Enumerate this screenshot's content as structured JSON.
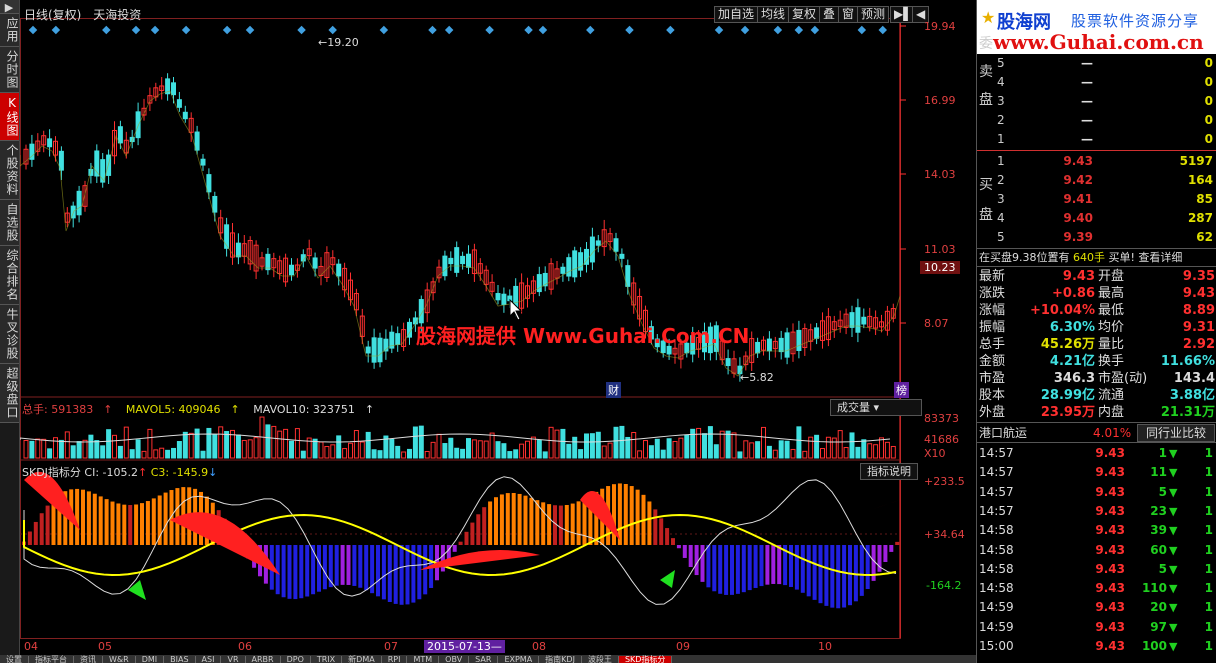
{
  "left_tabs": [
    "应用",
    "分时图",
    "K线图",
    "个股资料",
    "自选股",
    "综合排名",
    "牛叉诊股",
    "超级盘口"
  ],
  "chart_header": {
    "period": "日线(复权)",
    "stock": "天海投资"
  },
  "toolbar": [
    "加自选",
    "均线",
    "复权",
    "叠",
    "窗",
    "预测"
  ],
  "price_axis": [
    "19.94",
    "16.99",
    "14.03",
    "11.03",
    "10.23",
    "8.07"
  ],
  "peak_label": "19.20",
  "low_label": "5.82",
  "watermark": "股海网提供 Www.Guhai.Com.CN",
  "event_labels": {
    "fin": "财",
    "rank": "榜"
  },
  "volume": {
    "label": "总手: 591383",
    "mavol5": "MAVOL5: 409046",
    "mavol10": "MAVOL10: 323751",
    "axis": [
      "83373",
      "41686",
      "X10"
    ],
    "dropdown": "成交量"
  },
  "skdj": {
    "label": "SKDJ指标分",
    "c1": "CI: -105.2",
    "c3": "C3: -145.9",
    "button": "指标说明",
    "axis": [
      "+233.5",
      "+34.64",
      "-164.2"
    ]
  },
  "x_labels": [
    "04",
    "05",
    "06",
    "07",
    "08",
    "09",
    "10"
  ],
  "x_cursor_label": "2015-07-13—",
  "bottom_tabs": [
    "设置",
    "指标平台",
    "资讯",
    "W&R",
    "DMI",
    "BIAS",
    "ASI",
    "VR",
    "ARBR",
    "DPO",
    "TRIX",
    "新DMA",
    "RPI",
    "MTM",
    "OBV",
    "SAR",
    "EXPMA",
    "指南KDJ",
    "波段王",
    "SKD指标分"
  ],
  "banner": {
    "brand": "股海网",
    "slogan": "股票软件资源分享",
    "url": "www.Guhai.com.cn"
  },
  "side_labels": {
    "sell": "委卖盘",
    "buy": "买盘"
  },
  "sell_levels": [
    {
      "lv": "5",
      "price": "—",
      "vol": "0"
    },
    {
      "lv": "4",
      "price": "—",
      "vol": "0"
    },
    {
      "lv": "3",
      "price": "—",
      "vol": "0"
    },
    {
      "lv": "2",
      "price": "—",
      "vol": "0"
    },
    {
      "lv": "1",
      "price": "—",
      "vol": "0"
    }
  ],
  "buy_levels": [
    {
      "lv": "1",
      "price": "9.43",
      "vol": "5197"
    },
    {
      "lv": "2",
      "price": "9.42",
      "vol": "164"
    },
    {
      "lv": "3",
      "price": "9.41",
      "vol": "85"
    },
    {
      "lv": "4",
      "price": "9.40",
      "vol": "287"
    },
    {
      "lv": "5",
      "price": "9.39",
      "vol": "62"
    }
  ],
  "order_info": {
    "text": "在买盘9.38位置有",
    "qty": "640手",
    "buy1": "买单!",
    "detail": "查看详细"
  },
  "quote": [
    {
      "k": "最新",
      "v": "9.43",
      "vc": "red",
      "k2": "开盘",
      "v2": "9.35",
      "v2c": "red"
    },
    {
      "k": "涨跌",
      "v": "+0.86",
      "vc": "red",
      "k2": "最高",
      "v2": "9.43",
      "v2c": "red"
    },
    {
      "k": "涨幅",
      "v": "+10.04%",
      "vc": "red",
      "k2": "最低",
      "v2": "8.89",
      "v2c": "red"
    },
    {
      "k": "振幅",
      "v": "6.30%",
      "vc": "cyan",
      "k2": "均价",
      "v2": "9.31",
      "v2c": "red"
    },
    {
      "k": "总手",
      "v": "45.26万",
      "vc": "yel",
      "k2": "量比",
      "v2": "2.92",
      "v2c": "red"
    },
    {
      "k": "金额",
      "v": "4.21亿",
      "vc": "cyan",
      "k2": "换手",
      "v2": "11.66%",
      "v2c": "cyan"
    },
    {
      "k": "市盈",
      "v": "346.3",
      "vc": "wht",
      "k2": "市盈(动)",
      "v2": "143.4",
      "v2c": "wht"
    },
    {
      "k": "股本",
      "v": "28.99亿",
      "vc": "cyan",
      "k2": "流通",
      "v2": "3.88亿",
      "v2c": "cyan"
    },
    {
      "k": "外盘",
      "v": "23.95万",
      "vc": "red",
      "k2": "内盘",
      "v2": "21.31万",
      "v2c": "grn"
    }
  ],
  "industry": {
    "name": "港口航运",
    "pct": "4.01%",
    "compare": "同行业比较"
  },
  "ticks": [
    {
      "t": "14:57",
      "p": "9.43",
      "n": "1",
      "c": "1"
    },
    {
      "t": "14:57",
      "p": "9.43",
      "n": "11",
      "c": "1"
    },
    {
      "t": "14:57",
      "p": "9.43",
      "n": "5",
      "c": "1"
    },
    {
      "t": "14:57",
      "p": "9.43",
      "n": "23",
      "c": "1"
    },
    {
      "t": "14:58",
      "p": "9.43",
      "n": "39",
      "c": "1"
    },
    {
      "t": "14:58",
      "p": "9.43",
      "n": "60",
      "c": "1"
    },
    {
      "t": "14:58",
      "p": "9.43",
      "n": "5",
      "c": "1"
    },
    {
      "t": "14:58",
      "p": "9.43",
      "n": "110",
      "c": "1"
    },
    {
      "t": "14:59",
      "p": "9.43",
      "n": "20",
      "c": "1"
    },
    {
      "t": "14:59",
      "p": "9.43",
      "n": "97",
      "c": "1"
    },
    {
      "t": "15:00",
      "p": "9.43",
      "n": "100",
      "c": "1"
    }
  ],
  "colors": {
    "up": "#ff3030",
    "down": "#40e0e0",
    "ma": "#ffff00",
    "grid": "#802020"
  }
}
